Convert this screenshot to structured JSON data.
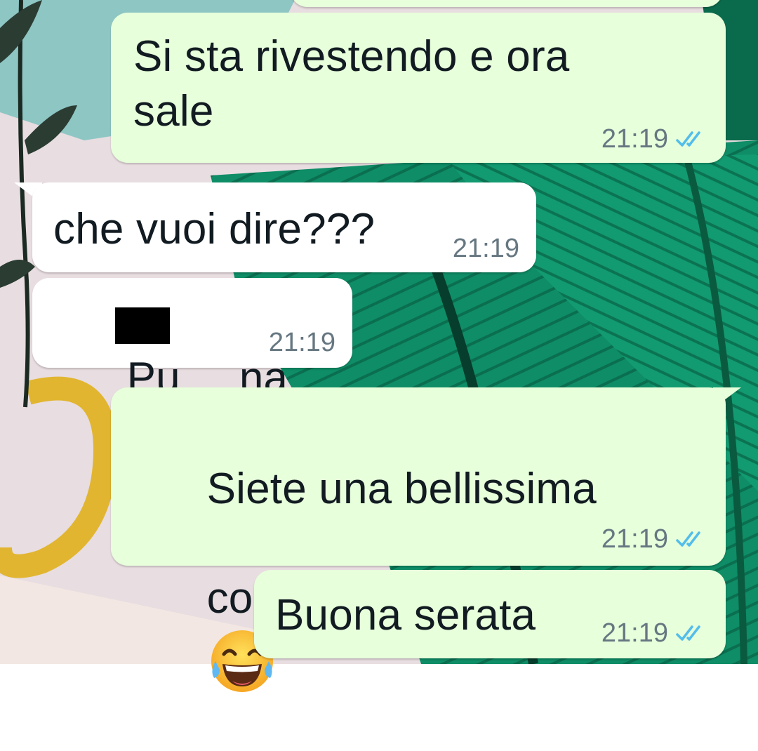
{
  "messages": [
    {
      "text": "",
      "time": "",
      "ticks": "double-check-icon",
      "direction": "outgoing"
    },
    {
      "text": "Si sta rivestendo e ora\nsale",
      "time": "21:19",
      "ticks": "double-check-icon",
      "direction": "outgoing"
    },
    {
      "text": "che vuoi dire???",
      "time": "21:19",
      "direction": "incoming"
    },
    {
      "text_visible_start": "Pu",
      "text_visible_end": "na",
      "time": "21:19",
      "direction": "incoming",
      "redacted": true
    },
    {
      "text_line1": "Siete una bellissima",
      "text_line2": "coppia",
      "emoji": "face-with-tears-of-joy-icon",
      "time": "21:19",
      "ticks": "double-check-icon",
      "direction": "outgoing"
    },
    {
      "text": "Buona serata",
      "time": "21:19",
      "ticks": "double-check-icon",
      "direction": "outgoing"
    }
  ],
  "colors": {
    "outgoing_bubble": "#e7ffdb",
    "incoming_bubble": "#ffffff",
    "text": "#111b21",
    "meta": "#667781",
    "read_ticks": "#53bdeb",
    "wallpaper_green": "#0d8a63",
    "wallpaper_light": "#e9dfe2",
    "wallpaper_yellow": "#e1b52f"
  }
}
